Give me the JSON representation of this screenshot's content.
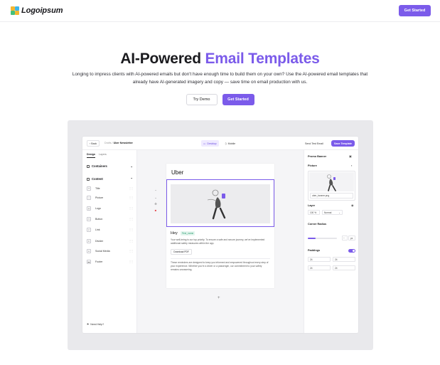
{
  "header": {
    "logo_text": "Logoipsum",
    "cta_label": "Get Started"
  },
  "hero": {
    "title_part1": "AI-Powered",
    "title_part2": "Email Templates",
    "subtitle": "Longing to impress clients with AI-powered emails but don't have enough time to build them on your own? Use the AI-powered email templates that already have AI-generated imagery and copy — save time on email production with us.",
    "try_demo_label": "Try Demo",
    "cta_label": "Get Started"
  },
  "editor": {
    "topbar": {
      "back_label": "Back",
      "crumb_parent": "Drafts /",
      "crumb_current": "Uber Newsletter",
      "device_desktop": "Desktop",
      "device_mobile": "Mobile",
      "send_test_label": "Send Test Email",
      "save_label": "Save Template"
    },
    "left_panel": {
      "tabs": [
        "Design",
        "Layers"
      ],
      "containers_label": "Containers",
      "content_label": "Content",
      "items": [
        {
          "label": "Title",
          "icon": "title-icon"
        },
        {
          "label": "Picture",
          "icon": "picture-icon"
        },
        {
          "label": "Logo",
          "icon": "logo-icon"
        },
        {
          "label": "Button",
          "icon": "button-icon"
        },
        {
          "label": "Link",
          "icon": "link-icon"
        },
        {
          "label": "Divider",
          "icon": "divider-icon"
        },
        {
          "label": "Social Media",
          "icon": "social-media-icon"
        },
        {
          "label": "Footer",
          "icon": "footer-icon"
        }
      ],
      "help_label": "Need Help?"
    },
    "email": {
      "brand": "Uber",
      "greeting": "Hey",
      "name_tag": "First_name",
      "body": "Your well-being is our top priority. To ensure a safe and secure journey, we've implemented additional safety measures within the app.",
      "download_label": "Download PDF",
      "footer_text": "These reminders are designed to keep you informed and empowered throughout every step of your experience. Whether you're a driver or a passenger, our commitment to your safety remains unwavering."
    },
    "right_panel": {
      "title": "Promo Banner",
      "picture_label": "Picture",
      "filename": "uber_banner.png",
      "layer_label": "Layer",
      "opacity_value": "100",
      "opacity_unit": "%",
      "blend_mode": "Normal",
      "corner_radius_label": "Corner Radius",
      "corner_radius_unit": "px",
      "paddings_label": "Paddings",
      "paddings": [
        "24",
        "24",
        "24",
        "24"
      ]
    }
  },
  "colors": {
    "accent": "#7b5bea",
    "frame_bg": "#e9e9ec"
  }
}
